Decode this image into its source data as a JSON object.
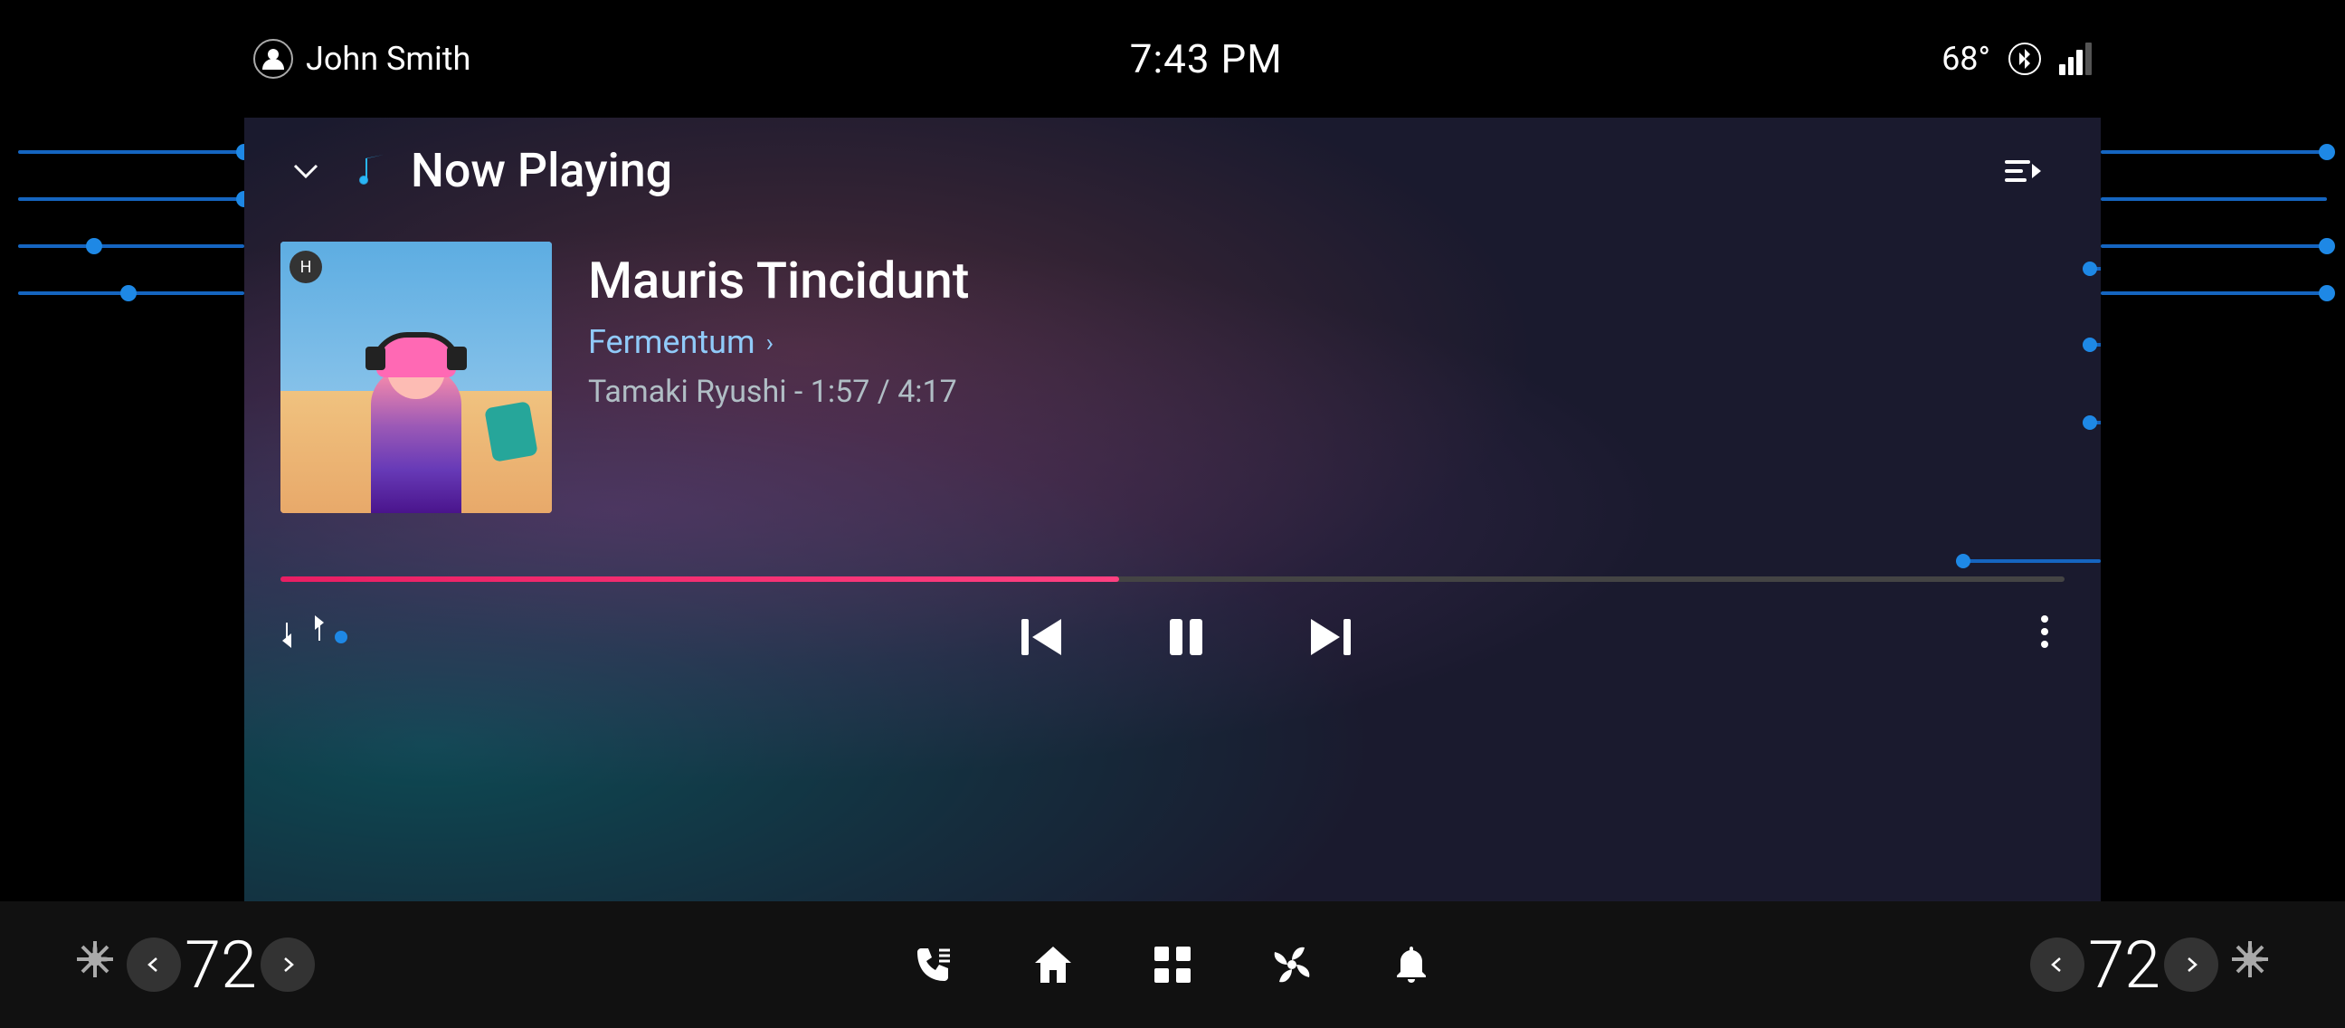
{
  "statusBar": {
    "user": "John Smith",
    "time": "7:43 PM",
    "temperature": "68°"
  },
  "header": {
    "title": "Now Playing",
    "chevron": "▾",
    "musicIcon": "🎵"
  },
  "track": {
    "title": "Mauris Tincidunt",
    "album": "Fermentum",
    "artistTime": "Tamaki Ryushi - 1:57 / 4:17",
    "progressPercent": 47
  },
  "controls": {
    "repeatLabel": "⇄",
    "prevLabel": "⏮",
    "pauseLabel": "⏸",
    "nextLabel": "⏭",
    "moreLabel": "⋮"
  },
  "bottomBar": {
    "leftTemp": "72",
    "rightTemp": "72",
    "homeIcon": "⌂",
    "gridIcon": "⊞",
    "fanIcon": "✦",
    "bellIcon": "🔔"
  }
}
